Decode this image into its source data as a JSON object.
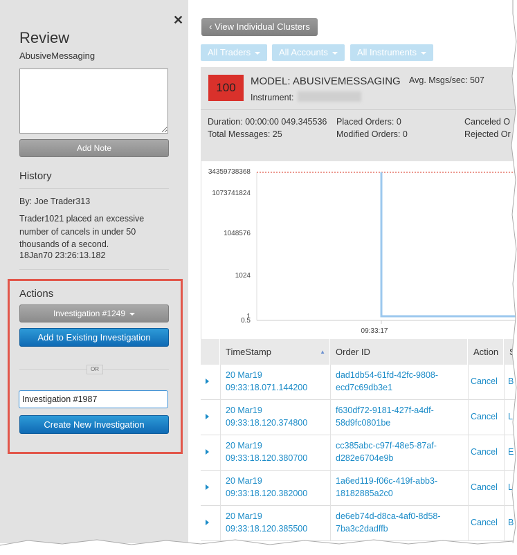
{
  "review": {
    "title": "Review",
    "subtitle": "AbusiveMessaging",
    "note_value": "",
    "add_note_label": "Add Note",
    "history_title": "History",
    "history_by": "By: Joe Trader313",
    "history_text": "Trader1021 placed an excessive number of cancels in under 50 thousands of a second.",
    "history_time": "18Jan70 23:26:13.182"
  },
  "actions": {
    "title": "Actions",
    "investigation_select": "Investigation #1249",
    "add_existing_label": "Add to Existing Investigation",
    "or_label": "OR",
    "new_investigation_value": "Investigation #1987",
    "create_new_label": "Create New Investigation"
  },
  "toolbar": {
    "back_label": "View Individual Clusters",
    "filters": [
      "All Traders",
      "All Accounts",
      "All Instruments"
    ]
  },
  "summary": {
    "score": "100",
    "model": "MODEL: ABUSIVEMESSAGING",
    "avg_msgs": "Avg. Msgs/sec: 507",
    "instrument_label": "Instrument:",
    "duration": "Duration: 00:00:00 049.345536",
    "total_messages": "Total Messages: 25",
    "placed_orders": "Placed Orders: 0",
    "modified_orders": "Modified Orders: 0",
    "canceled_orders": "Canceled O",
    "rejected_orders": "Rejected Or"
  },
  "chart_data": {
    "type": "line",
    "yscale": "log",
    "y_ticks": [
      "34359738368",
      "1073741824",
      "1048576",
      "1024",
      "1",
      "0.5"
    ],
    "x_ticks": [
      "09:33:17"
    ],
    "threshold": 34359738368,
    "series": [
      {
        "points": [
          [
            0,
            34359738368
          ],
          [
            0.2,
            1
          ]
        ]
      }
    ],
    "colors": {
      "line": "#9cc8ee",
      "threshold": "#e05a4a"
    }
  },
  "table": {
    "columns": [
      "TimeStamp",
      "Order ID",
      "Action",
      "S"
    ],
    "rows": [
      {
        "ts1": "20 Mar19",
        "ts2": "09:33:18.071.144200",
        "id1": "dad1db54-61fd-42fc-9808-",
        "id2": "ecd7c69db3e1",
        "action": "Cancel",
        "side": "B"
      },
      {
        "ts1": "20 Mar19",
        "ts2": "09:33:18.120.374800",
        "id1": "f630df72-9181-427f-a4df-",
        "id2": "58d9fc0801be",
        "action": "Cancel",
        "side": "L"
      },
      {
        "ts1": "20 Mar19",
        "ts2": "09:33:18.120.380700",
        "id1": "cc385abc-c97f-48e5-87af-",
        "id2": "d282e6704e9b",
        "action": "Cancel",
        "side": "E"
      },
      {
        "ts1": "20 Mar19",
        "ts2": "09:33:18.120.382000",
        "id1": "1a6ed119-f06c-419f-abb3-",
        "id2": "18182885a2c0",
        "action": "Cancel",
        "side": "L"
      },
      {
        "ts1": "20 Mar19",
        "ts2": "09:33:18.120.385500",
        "id1": "de6eb74d-d8ca-4af0-8d58-",
        "id2": "7ba3c2dadffb",
        "action": "Cancel",
        "side": "B"
      }
    ]
  }
}
